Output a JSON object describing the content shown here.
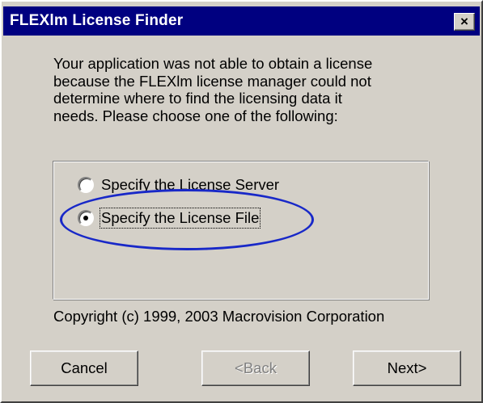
{
  "window": {
    "title": "FLEXlm License Finder",
    "close_glyph": "×"
  },
  "message": {
    "lines": [
      "Your application was not able to obtain a license",
      "because the FLEXlm license manager could not",
      "determine where to find the licensing data it",
      "needs.  Please choose one of the following:"
    ]
  },
  "options": [
    {
      "label": "Specify the License Server",
      "selected": false
    },
    {
      "label": "Specify the License File",
      "selected": true
    }
  ],
  "annotation": {
    "highlight_color": "#1828c8"
  },
  "copyright": "Copyright (c) 1999, 2003 Macrovision Corporation",
  "buttons": {
    "cancel": "Cancel",
    "back": "<Back",
    "next": "Next>"
  },
  "colors": {
    "titlebar": "#000080",
    "face": "#d4d0c8"
  }
}
